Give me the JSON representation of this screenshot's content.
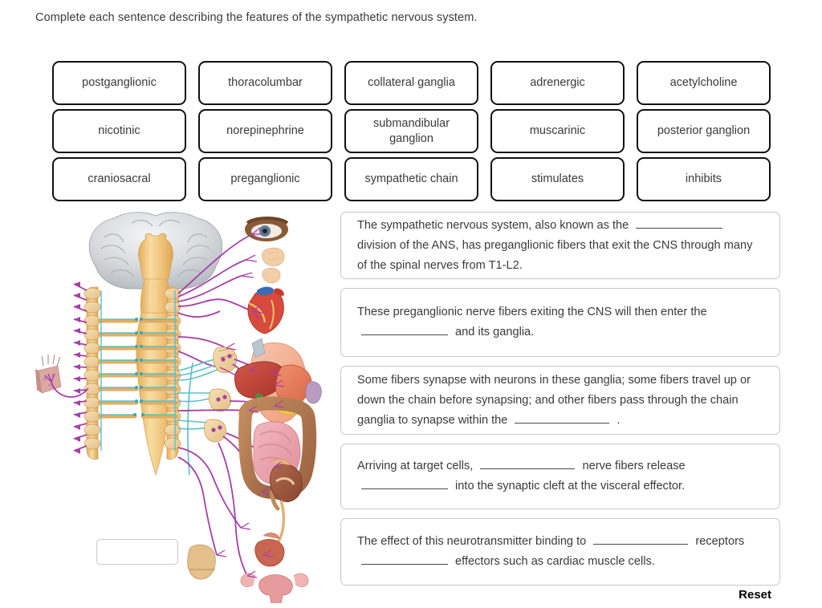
{
  "prompt": "Complete each sentence describing the features of the sympathetic nervous system.",
  "word_bank": {
    "rows": [
      [
        {
          "label": "postganglionic"
        },
        {
          "label": "thoracolumbar"
        },
        {
          "label": "collateral ganglia"
        },
        {
          "label": "adrenergic"
        },
        {
          "label": "acetylcholine"
        }
      ],
      [
        {
          "label": "nicotinic"
        },
        {
          "label": "norepinephrine"
        },
        {
          "label": "submandibular ganglion"
        },
        {
          "label": "muscarinic"
        },
        {
          "label": "posterior ganglion"
        }
      ],
      [
        {
          "label": "craniosacral"
        },
        {
          "label": "preganglionic"
        },
        {
          "label": "sympathetic chain"
        },
        {
          "label": "stimulates"
        },
        {
          "label": "inhibits"
        }
      ]
    ]
  },
  "sentences": [
    {
      "id": "sentence-1",
      "parts": [
        {
          "type": "text",
          "value": "The sympathetic nervous system, also known as the "
        },
        {
          "type": "blank"
        },
        {
          "type": "text",
          "value": " division of the ANS, has preganglionic fibers that exit the CNS through many of the spinal nerves from T1-L2."
        }
      ]
    },
    {
      "id": "sentence-2",
      "parts": [
        {
          "type": "text",
          "value": "These preganglionic nerve fibers exiting the CNS will then enter the "
        },
        {
          "type": "blank"
        },
        {
          "type": "text",
          "value": " and its ganglia."
        }
      ]
    },
    {
      "id": "sentence-3",
      "parts": [
        {
          "type": "text",
          "value": "Some fibers synapse with neurons in these ganglia; some fibers travel up or down the chain before synapsing; and other fibers pass through the chain ganglia to synapse within the "
        },
        {
          "type": "blank"
        },
        {
          "type": "text",
          "value": " ."
        }
      ]
    },
    {
      "id": "sentence-4",
      "parts": [
        {
          "type": "text",
          "value": "Arriving at target cells, "
        },
        {
          "type": "blank"
        },
        {
          "type": "text",
          "value": " nerve fibers release "
        },
        {
          "type": "blank"
        },
        {
          "type": "text",
          "value": " into the synaptic cleft at the visceral effector."
        }
      ]
    },
    {
      "id": "sentence-5",
      "parts": [
        {
          "type": "text",
          "value": "The effect of this neurotransmitter binding to "
        },
        {
          "type": "blank"
        },
        {
          "type": "text",
          "value": " receptors "
        },
        {
          "type": "blank"
        },
        {
          "type": "text",
          "value": " effectors such as cardiac muscle cells."
        }
      ]
    }
  ],
  "reset": {
    "label": "Reset"
  },
  "figure": {
    "caption": "",
    "legend": {
      "preganglionic_color": "#5bbfc7",
      "postganglionic_color": "#a63fa8"
    },
    "colors": {
      "brain": "#d5d8dc",
      "spinal_cord": "#f2cb7a",
      "ganglia_chain": "#e9bc6b",
      "preganglionic_fiber": "#5bbfc7",
      "postganglionic_fiber": "#a63fa8",
      "liver": "#c44436",
      "stomach": "#e8795c",
      "intestine": "#e8a0a8",
      "colon": "#b0714c",
      "kidney": "#9c5a42",
      "bladder": "#c46a55",
      "lung": "#f0a385",
      "heart": "#d84a3c",
      "eye": "#8a5a36",
      "skin": "#d9a9a0"
    },
    "organs": [
      {
        "name": "eye"
      },
      {
        "name": "salivary-gland-upper"
      },
      {
        "name": "salivary-gland-lower"
      },
      {
        "name": "heart"
      },
      {
        "name": "lung"
      },
      {
        "name": "liver"
      },
      {
        "name": "stomach"
      },
      {
        "name": "spleen"
      },
      {
        "name": "colon"
      },
      {
        "name": "small-intestine"
      },
      {
        "name": "kidney"
      },
      {
        "name": "bladder"
      },
      {
        "name": "uterus-ovaries"
      },
      {
        "name": "skin-patch"
      }
    ]
  }
}
